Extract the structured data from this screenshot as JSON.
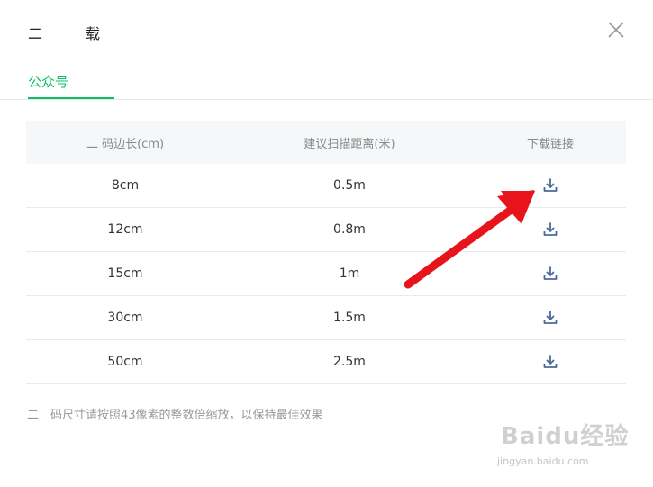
{
  "dialog": {
    "title_part1": "二",
    "title_part2": "载"
  },
  "tabs": [
    {
      "label": "公众号",
      "active": true
    }
  ],
  "table": {
    "headers": [
      "二 码边长(cm)",
      "建议扫描距离(米)",
      "下载链接"
    ],
    "rows": [
      {
        "size": "8cm",
        "distance": "0.5m"
      },
      {
        "size": "12cm",
        "distance": "0.8m"
      },
      {
        "size": "15cm",
        "distance": "1m"
      },
      {
        "size": "30cm",
        "distance": "1.5m"
      },
      {
        "size": "50cm",
        "distance": "2.5m"
      }
    ]
  },
  "note": "二　码尺寸请按照43像素的整数倍缩放，以保持最佳效果",
  "icons": {
    "close": "close-icon",
    "download": "download-icon"
  },
  "colors": {
    "accent": "#07c160",
    "icon": "#4a6a9b",
    "annotation_arrow": "#e8141b"
  },
  "watermark": {
    "brand": "Baidu经验",
    "url": "jingyan.baidu.com"
  }
}
